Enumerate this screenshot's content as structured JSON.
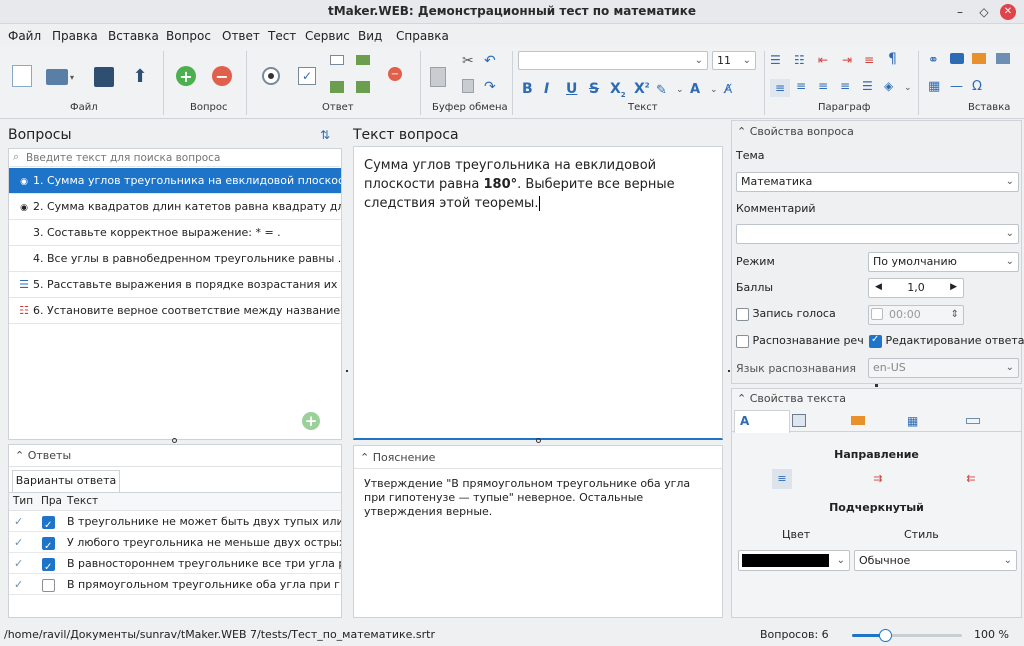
{
  "window": {
    "title": "tMaker.WEB: Демонстрационный тест по математике"
  },
  "menu": [
    "Файл",
    "Правка",
    "Вставка",
    "Вопрос",
    "Ответ",
    "Тест",
    "Сервис",
    "Вид",
    "Справка"
  ],
  "ribbon": {
    "groups": {
      "file": "Файл",
      "question": "Вопрос",
      "answer": "Ответ",
      "clipboard": "Буфер обмена",
      "text": "Текст",
      "paragraph": "Параграф",
      "insert": "Вставка"
    },
    "font_name": "",
    "font_size": "11",
    "format": {
      "bold": "B",
      "italic": "I",
      "underline": "U",
      "strike": "S",
      "sub": "X",
      "sup": "X"
    }
  },
  "questions": {
    "title": "Вопросы",
    "search_placeholder": "Введите текст для поиска вопроса",
    "items": [
      {
        "icon": "radio-icon",
        "label": "1. Сумма углов треугольника на евклидовой плоскост..."
      },
      {
        "icon": "radio-icon",
        "label": "2. Сумма квадратов длин катетов равна квадрату дли..."
      },
      {
        "icon": "",
        "label": "3. Составьте корректное выражение:  * = ."
      },
      {
        "icon": "",
        "label": "4. Все углы в равнобедренном треугольнике равны  ..."
      },
      {
        "icon": "order-icon",
        "label": "5. Расставьте выражения в порядке возрастания их ..."
      },
      {
        "icon": "match-icon",
        "label": "6. Установите верное соответствие между название..."
      }
    ]
  },
  "answers": {
    "title": "Ответы",
    "tab": "Варианты ответа",
    "headers": [
      "Тип",
      "Пра",
      "Текст"
    ],
    "rows": [
      {
        "correct": true,
        "text": "В треугольнике не может быть двух тупых или д..."
      },
      {
        "correct": true,
        "text": "У любого треугольника не меньше двух острых ..."
      },
      {
        "correct": true,
        "text": "В равностороннем треугольнике все три угла ра..."
      },
      {
        "correct": false,
        "text": "В прямоугольном треугольнике оба угла при гип..."
      }
    ]
  },
  "question_text": {
    "title": "Текст вопроса",
    "part1": "Сумма углов треугольника на евклидовой плоскости равна ",
    "bold": "180°",
    "part2": ". Выберите все верные следствия этой теоремы."
  },
  "explanation": {
    "title": "Пояснение",
    "text": "Утверждение \"В прямоугольном треугольнике оба угла при гипотенузе — тупые\" неверное. Остальные утверждения верные."
  },
  "question_props": {
    "title": "Свойства вопроса",
    "topic_label": "Тема",
    "topic_value": "Математика",
    "comment_label": "Комментарий",
    "comment_value": "",
    "mode_label": "Режим",
    "mode_value": "По умолчанию",
    "score_label": "Баллы",
    "score_value": "1,0",
    "voice_label": "Запись голоса",
    "voice_time": "00:00",
    "speech_label": "Распознавание речи",
    "edit_label": "Редактирование ответа",
    "lang_label": "Язык распознавания",
    "lang_value": "en-US"
  },
  "text_props": {
    "title": "Свойства текста",
    "direction_label": "Направление",
    "underline_label": "Подчеркнутый",
    "color_label": "Цвет",
    "style_label": "Стиль",
    "style_value": "Обычное",
    "color_value": "#000000"
  },
  "status": {
    "path": "/home/ravil/Документы/sunrav/tMaker.WEB 7/tests/Тест_по_математике.srtr",
    "count": "Вопросов: 6",
    "zoom": "100 %",
    "zoom_fraction": 0.3
  }
}
